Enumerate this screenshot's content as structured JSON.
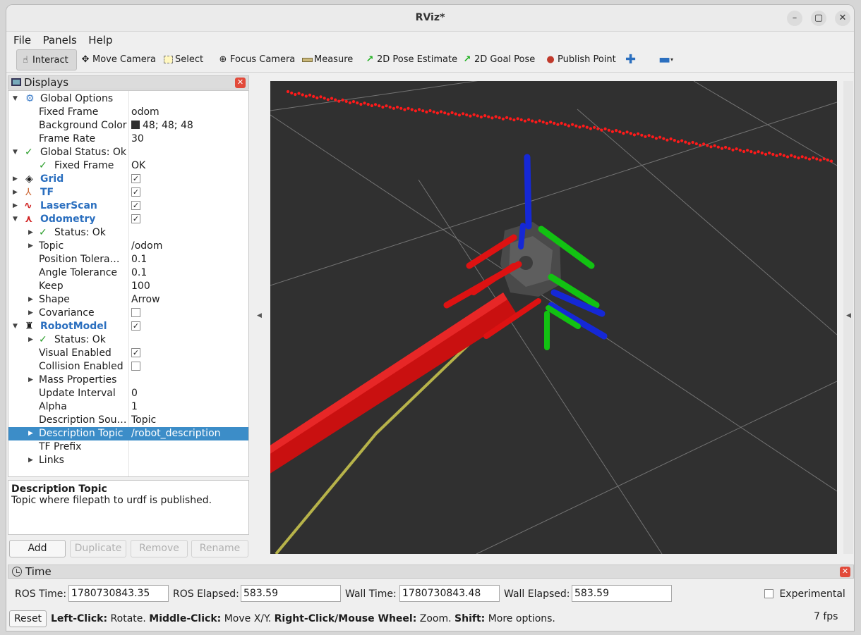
{
  "window": {
    "title": "RViz*"
  },
  "menu": [
    "File",
    "Panels",
    "Help"
  ],
  "toolbar": {
    "interact": "Interact",
    "move_camera": "Move Camera",
    "select": "Select",
    "focus_camera": "Focus Camera",
    "measure": "Measure",
    "pose_estimate": "2D Pose Estimate",
    "goal_pose": "2D Goal Pose",
    "publish_point": "Publish Point"
  },
  "displays": {
    "title": "Displays",
    "rows": {
      "global_options": "Global Options",
      "fixed_frame": "Fixed Frame",
      "fixed_frame_val": "odom",
      "bg_color": "Background Color",
      "bg_color_val": "48; 48; 48",
      "frame_rate": "Frame Rate",
      "frame_rate_val": "30",
      "global_status": "Global Status: Ok",
      "fixed_frame_status": "Fixed Frame",
      "fixed_frame_status_val": "OK",
      "grid": "Grid",
      "tf": "TF",
      "laserscan": "LaserScan",
      "odometry": "Odometry",
      "odom_status": "Status: Ok",
      "topic": "Topic",
      "topic_val": "/odom",
      "pos_tol": "Position Tolera…",
      "pos_tol_val": "0.1",
      "ang_tol": "Angle Tolerance",
      "ang_tol_val": "0.1",
      "keep": "Keep",
      "keep_val": "100",
      "shape": "Shape",
      "shape_val": "Arrow",
      "covariance": "Covariance",
      "robotmodel": "RobotModel",
      "rm_status": "Status: Ok",
      "visual_enabled": "Visual Enabled",
      "collision_enabled": "Collision Enabled",
      "mass_props": "Mass Properties",
      "update_interval": "Update Interval",
      "update_interval_val": "0",
      "alpha": "Alpha",
      "alpha_val": "1",
      "desc_source": "Description Sou…",
      "desc_source_val": "Topic",
      "desc_topic": "Description Topic",
      "desc_topic_val": "/robot_description",
      "tf_prefix": "TF Prefix",
      "links": "Links"
    },
    "description": {
      "title": "Description Topic",
      "text": "Topic where filepath to urdf is published."
    },
    "buttons": {
      "add": "Add",
      "duplicate": "Duplicate",
      "remove": "Remove",
      "rename": "Rename"
    }
  },
  "time": {
    "title": "Time",
    "ros_time_label": "ROS Time:",
    "ros_time": "1780730843.35",
    "ros_elapsed_label": "ROS Elapsed:",
    "ros_elapsed": "583.59",
    "wall_time_label": "Wall Time:",
    "wall_time": "1780730843.48",
    "wall_elapsed_label": "Wall Elapsed:",
    "wall_elapsed": "583.59",
    "experimental": "Experimental"
  },
  "status": {
    "reset": "Reset",
    "left_click": "Left-Click:",
    "left_click_desc": " Rotate. ",
    "middle_click": "Middle-Click:",
    "middle_click_desc": " Move X/Y. ",
    "right_click": "Right-Click/Mouse Wheel:",
    "right_click_desc": " Zoom. ",
    "shift": "Shift:",
    "shift_desc": " More options.",
    "fps": "7 fps"
  },
  "colors": {
    "view_background": "#303030",
    "selection": "#3c8dc8",
    "axis_x": "#e01010",
    "axis_y": "#10c010",
    "axis_z": "#1020d0",
    "path": "#b7b34a",
    "laser": "#ff1a1a"
  }
}
